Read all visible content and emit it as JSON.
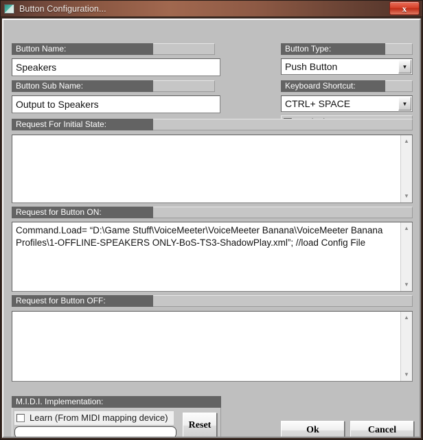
{
  "window": {
    "title": "Button Configuration...",
    "icon": "window-icon",
    "close_label": "x",
    "accent_titlebar": "#8a5742",
    "close_color": "#c02d17",
    "dialog_bg": "#bfbfbf",
    "label_bg": "#636363"
  },
  "fields": {
    "button_name": {
      "label": "Button Name:",
      "value": "Speakers"
    },
    "button_sub_name": {
      "label": "Button Sub Name:",
      "value": "Output to Speakers"
    },
    "button_type": {
      "label": "Button Type:",
      "value": "Push Button"
    },
    "keyboard_shortcut": {
      "label": "Keyboard Shortcut:",
      "value": "CTRL+ SPACE"
    },
    "exclusive_key": {
      "label": "Exclusive Key",
      "checked": false
    },
    "initial_state": {
      "label": "Request For Initial State:",
      "value": ""
    },
    "button_on": {
      "label": "Request for Button ON:",
      "value": "Command.Load= “D:\\Game Stuff\\VoiceMeeter\\VoiceMeeter Banana\\VoiceMeeter Banana Profiles\\1-OFFLINE-SPEAKERS ONLY-BoS-TS3-ShadowPlay.xml”; //load Config File"
    },
    "button_off": {
      "label": "Request for Button OFF:",
      "value": ""
    }
  },
  "midi": {
    "label": "M.I.D.I. Implementation:",
    "learn_label": "Learn (From MIDI mapping device)",
    "learn_checked": false,
    "mapping_value": "",
    "reset_label": "Reset"
  },
  "actions": {
    "ok_label": "Ok",
    "cancel_label": "Cancel"
  },
  "scrollbar": {
    "up_glyph": "▲",
    "down_glyph": "▼"
  },
  "combo": {
    "arrow_glyph": "▼"
  }
}
